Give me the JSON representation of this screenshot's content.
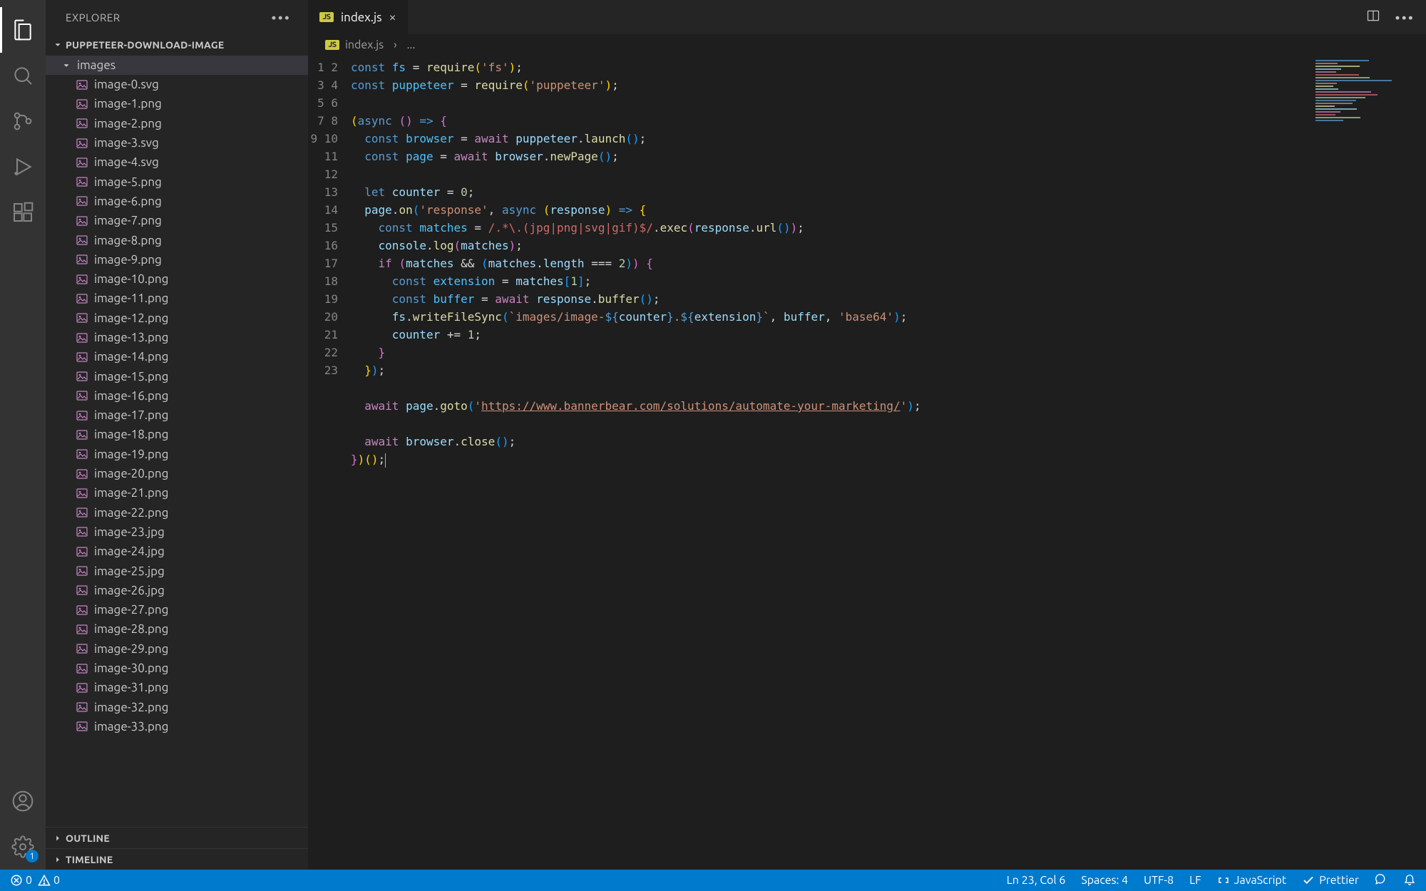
{
  "sidebar": {
    "title": "EXPLORER",
    "project": "PUPPETEER-DOWNLOAD-IMAGE",
    "folder": "images",
    "files": [
      "image-0.svg",
      "image-1.png",
      "image-2.png",
      "image-3.svg",
      "image-4.svg",
      "image-5.png",
      "image-6.png",
      "image-7.png",
      "image-8.png",
      "image-9.png",
      "image-10.png",
      "image-11.png",
      "image-12.png",
      "image-13.png",
      "image-14.png",
      "image-15.png",
      "image-16.png",
      "image-17.png",
      "image-18.png",
      "image-19.png",
      "image-20.png",
      "image-21.png",
      "image-22.png",
      "image-23.jpg",
      "image-24.jpg",
      "image-25.jpg",
      "image-26.jpg",
      "image-27.png",
      "image-28.png",
      "image-29.png",
      "image-30.png",
      "image-31.png",
      "image-32.png",
      "image-33.png"
    ],
    "sections": [
      "OUTLINE",
      "TIMELINE"
    ]
  },
  "settings_badge": "1",
  "tab": {
    "filename": "index.js"
  },
  "breadcrumb": {
    "file": "index.js",
    "rest": "..."
  },
  "code_lines": 23,
  "code": {
    "l1": {
      "a": "const ",
      "b": "fs",
      "c": " = ",
      "d": "require",
      "e": "(",
      "f": "'fs'",
      "g": ")",
      "h": ";"
    },
    "l2": {
      "a": "const ",
      "b": "puppeteer",
      "c": " = ",
      "d": "require",
      "e": "(",
      "f": "'puppeteer'",
      "g": ")",
      "h": ";"
    },
    "l4": {
      "a": "(",
      "b": "async",
      "c": " ",
      "d": "()",
      "e": " ",
      "f": "=>",
      "g": " ",
      "h": "{"
    },
    "l5": {
      "a": "  ",
      "b": "const ",
      "c": "browser",
      "d": " = ",
      "e": "await ",
      "f": "puppeteer",
      "g": ".",
      "h": "launch",
      "i": "()",
      "j": ";"
    },
    "l6": {
      "a": "  ",
      "b": "const ",
      "c": "page",
      "d": " = ",
      "e": "await ",
      "f": "browser",
      "g": ".",
      "h": "newPage",
      "i": "()",
      "j": ";"
    },
    "l8": {
      "a": "  ",
      "b": "let ",
      "c": "counter",
      "d": " = ",
      "e": "0",
      "f": ";"
    },
    "l9": {
      "a": "  ",
      "b": "page",
      "c": ".",
      "d": "on",
      "e": "(",
      "f": "'response'",
      "g": ", ",
      "h": "async",
      "i": " ",
      "j": "(",
      "k": "response",
      "l": ")",
      "m": " ",
      "n": "=>",
      "o": " ",
      "p": "{"
    },
    "l10": {
      "a": "    ",
      "b": "const ",
      "c": "matches",
      "d": " = ",
      "e": "/",
      "f": ".*",
      "g": "\\.",
      "h": "(",
      "i": "jpg",
      "j": "|",
      "k": "png",
      "l": "|",
      "m": "svg",
      "n": "|",
      "o": "gif",
      "p": ")",
      "q": "$",
      "r": "/",
      "s": ".",
      "t": "exec",
      "u": "(",
      "v": "response",
      "w": ".",
      "x": "url",
      "y": "())",
      ";": ";"
    },
    "l11": {
      "a": "    ",
      "b": "console",
      "c": ".",
      "d": "log",
      "e": "(",
      "f": "matches",
      "g": ")",
      "h": ";"
    },
    "l12": {
      "a": "    ",
      "b": "if ",
      "c": "(",
      "d": "matches",
      "e": " && ",
      "f": "(",
      "g": "matches",
      "h": ".",
      "i": "length",
      "j": " === ",
      "k": "2",
      "l": "))",
      "m": " ",
      "n": "{"
    },
    "l13": {
      "a": "      ",
      "b": "const ",
      "c": "extension",
      "d": " = ",
      "e": "matches",
      "f": "[",
      "g": "1",
      "h": "]",
      "i": ";"
    },
    "l14": {
      "a": "      ",
      "b": "const ",
      "c": "buffer",
      "d": " = ",
      "e": "await ",
      "f": "response",
      "g": ".",
      "h": "buffer",
      "i": "()",
      "j": ";"
    },
    "l15": {
      "a": "      ",
      "b": "fs",
      "c": ".",
      "d": "writeFileSync",
      "e": "(",
      "f": "`images/image-",
      "g": "${",
      "h": "counter",
      "i": "}",
      "j": ".",
      "k": "${",
      "l": "extension",
      "m": "}",
      "n": "`",
      "o": ", ",
      "p": "buffer",
      "q": ", ",
      "r": "'base64'",
      "s": ")",
      "t": ";"
    },
    "l16": {
      "a": "      ",
      "b": "counter",
      "c": " += ",
      "d": "1",
      "e": ";"
    },
    "l17": {
      "a": "    ",
      "b": "}"
    },
    "l18": {
      "a": "  ",
      "b": "}",
      "c": ")",
      "d": ";"
    },
    "l20": {
      "a": "  ",
      "b": "await ",
      "c": "page",
      "d": ".",
      "e": "goto",
      "f": "(",
      "g": "'",
      "h": "https://www.bannerbear.com/solutions/automate-your-marketing/",
      "i": "'",
      "j": ")",
      "k": ";"
    },
    "l22": {
      "a": "  ",
      "b": "await ",
      "c": "browser",
      "d": ".",
      "e": "close",
      "f": "()",
      "g": ";"
    },
    "l23": {
      "a": "}",
      "b": ")",
      "c": "()",
      "d": ";"
    }
  },
  "status": {
    "errors": "0",
    "warnings": "0",
    "cursor": "Ln 23, Col 6",
    "spaces": "Spaces: 4",
    "encoding": "UTF-8",
    "eol": "LF",
    "language": "JavaScript",
    "prettier": "Prettier"
  }
}
